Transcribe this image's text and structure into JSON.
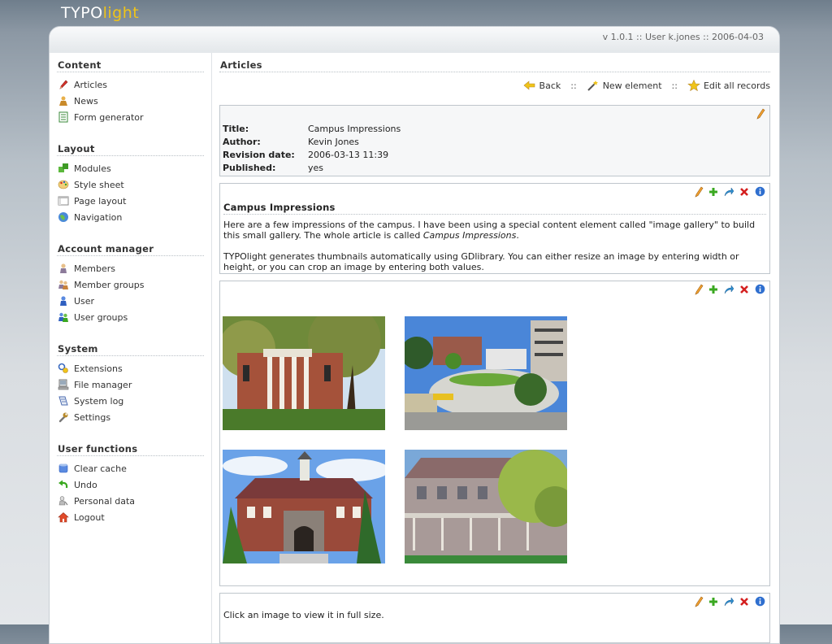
{
  "logo": {
    "part1": "TYPO",
    "part2": "light"
  },
  "topbar": {
    "status": "v 1.0.1 :: User k.jones :: 2006-04-03"
  },
  "sidebar": {
    "groups": [
      {
        "title": "Content",
        "items": [
          {
            "label": "Articles",
            "icon": "pencil-icon"
          },
          {
            "label": "News",
            "icon": "news-icon"
          },
          {
            "label": "Form generator",
            "icon": "form-icon"
          }
        ]
      },
      {
        "title": "Layout",
        "items": [
          {
            "label": "Modules",
            "icon": "modules-icon"
          },
          {
            "label": "Style sheet",
            "icon": "palette-icon"
          },
          {
            "label": "Page layout",
            "icon": "layout-icon"
          },
          {
            "label": "Navigation",
            "icon": "globe-icon"
          }
        ]
      },
      {
        "title": "Account manager",
        "items": [
          {
            "label": "Members",
            "icon": "member-icon"
          },
          {
            "label": "Member groups",
            "icon": "member-groups-icon"
          },
          {
            "label": "User",
            "icon": "user-icon"
          },
          {
            "label": "User groups",
            "icon": "user-groups-icon"
          }
        ]
      },
      {
        "title": "System",
        "items": [
          {
            "label": "Extensions",
            "icon": "extensions-icon"
          },
          {
            "label": "File manager",
            "icon": "file-manager-icon"
          },
          {
            "label": "System log",
            "icon": "log-icon"
          },
          {
            "label": "Settings",
            "icon": "wrench-icon"
          }
        ]
      },
      {
        "title": "User functions",
        "items": [
          {
            "label": "Clear cache",
            "icon": "database-icon"
          },
          {
            "label": "Undo",
            "icon": "undo-icon"
          },
          {
            "label": "Personal data",
            "icon": "personal-data-icon"
          },
          {
            "label": "Logout",
            "icon": "home-icon"
          }
        ]
      }
    ]
  },
  "main": {
    "heading": "Articles",
    "actions": {
      "back": "Back",
      "new_element": "New element",
      "edit_all": "Edit all records",
      "separator": "::"
    },
    "meta": {
      "title_label": "Title:",
      "title_value": "Campus Impressions",
      "author_label": "Author:",
      "author_value": "Kevin Jones",
      "revision_label": "Revision date:",
      "revision_value": "2006-03-13 11:39",
      "published_label": "Published:",
      "published_value": "yes"
    },
    "text_element": {
      "title": "Campus Impressions",
      "p1_a": "Here are a few impressions of the campus. I have been using a special content element called \"image gallery\" to build this small gallery. The whole article is called ",
      "p1_em": "Campus Impressions",
      "p1_b": ".",
      "p2": "TYPOlight generates thumbnails automatically using GDlibrary. You can either resize an image by entering width or height, or you can crop an image by entering both values."
    },
    "caption_element": {
      "text": "Click an image to view it in full size."
    }
  },
  "colors": {
    "accent": "#f0c419",
    "edit": "#f0a030",
    "add": "#3aa820",
    "delete": "#d42020",
    "info": "#2f6fcf"
  }
}
